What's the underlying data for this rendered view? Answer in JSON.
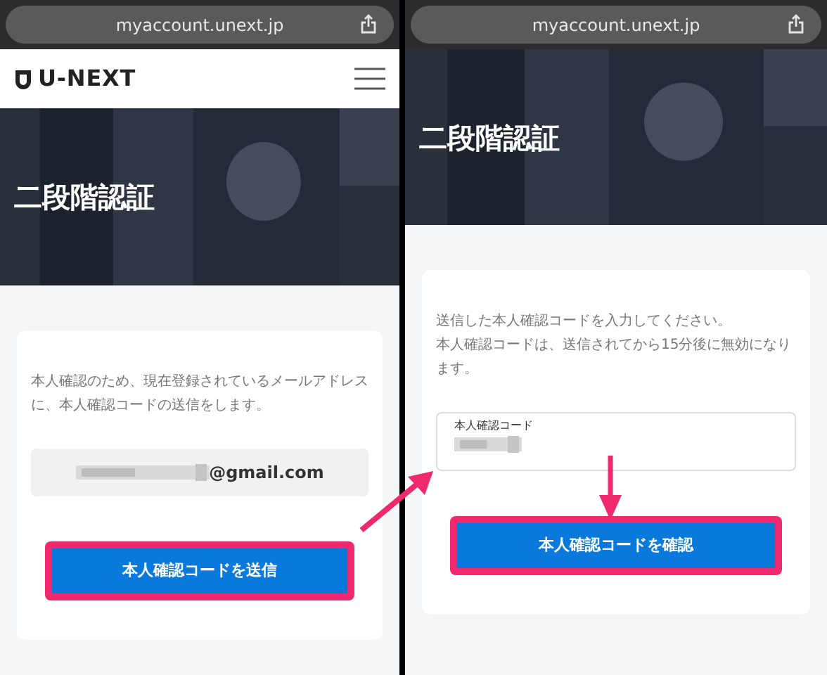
{
  "screens": [
    {
      "url": "myaccount.unext.jp",
      "header": {
        "logo": "U-NEXT"
      },
      "title": "二段階認証",
      "paragraphs": [
        "本人確認のため、現在登録されているメールアドレスに、本人確認コードの送信をします。"
      ],
      "field": {
        "kind": "readonly",
        "value": "@gmail.com",
        "redacted": true
      },
      "button": {
        "label": "本人確認コードを送信",
        "highlighted": true
      }
    },
    {
      "url": "myaccount.unext.jp",
      "title": "二段階認証",
      "paragraphs": [
        "送信した本人確認コードを入力してください。",
        "本人確認コードは、送信されてから15分後に無効になります。"
      ],
      "field": {
        "kind": "input",
        "label": "本人確認コード",
        "redacted": true
      },
      "button": {
        "label": "本人確認コードを確認",
        "highlighted": true
      }
    }
  ]
}
